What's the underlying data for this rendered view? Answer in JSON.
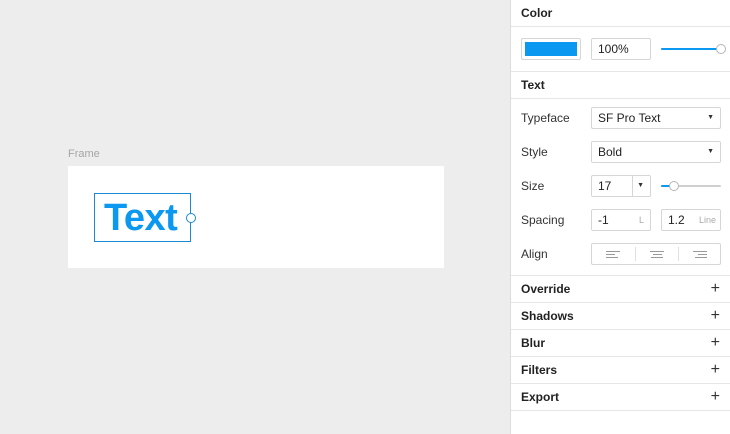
{
  "canvas": {
    "frame_label": "Frame",
    "text_layer": "Text",
    "text_color": "#0a98f0"
  },
  "panel": {
    "color": {
      "title": "Color",
      "swatch": "#0a98f0",
      "opacity": "100%",
      "opacity_fraction": 1.0
    },
    "text": {
      "title": "Text",
      "typeface_label": "Typeface",
      "typeface_value": "SF Pro Text",
      "style_label": "Style",
      "style_value": "Bold",
      "size_label": "Size",
      "size_value": "17",
      "spacing_label": "Spacing",
      "letter_spacing": "-1",
      "letter_spacing_unit": "L",
      "line_height": "1.2",
      "line_height_unit": "Line",
      "align_label": "Align"
    },
    "sections": [
      {
        "label": "Override"
      },
      {
        "label": "Shadows"
      },
      {
        "label": "Blur"
      },
      {
        "label": "Filters"
      },
      {
        "label": "Export"
      }
    ],
    "icons": {
      "caret": "▼",
      "plus": "+"
    }
  }
}
